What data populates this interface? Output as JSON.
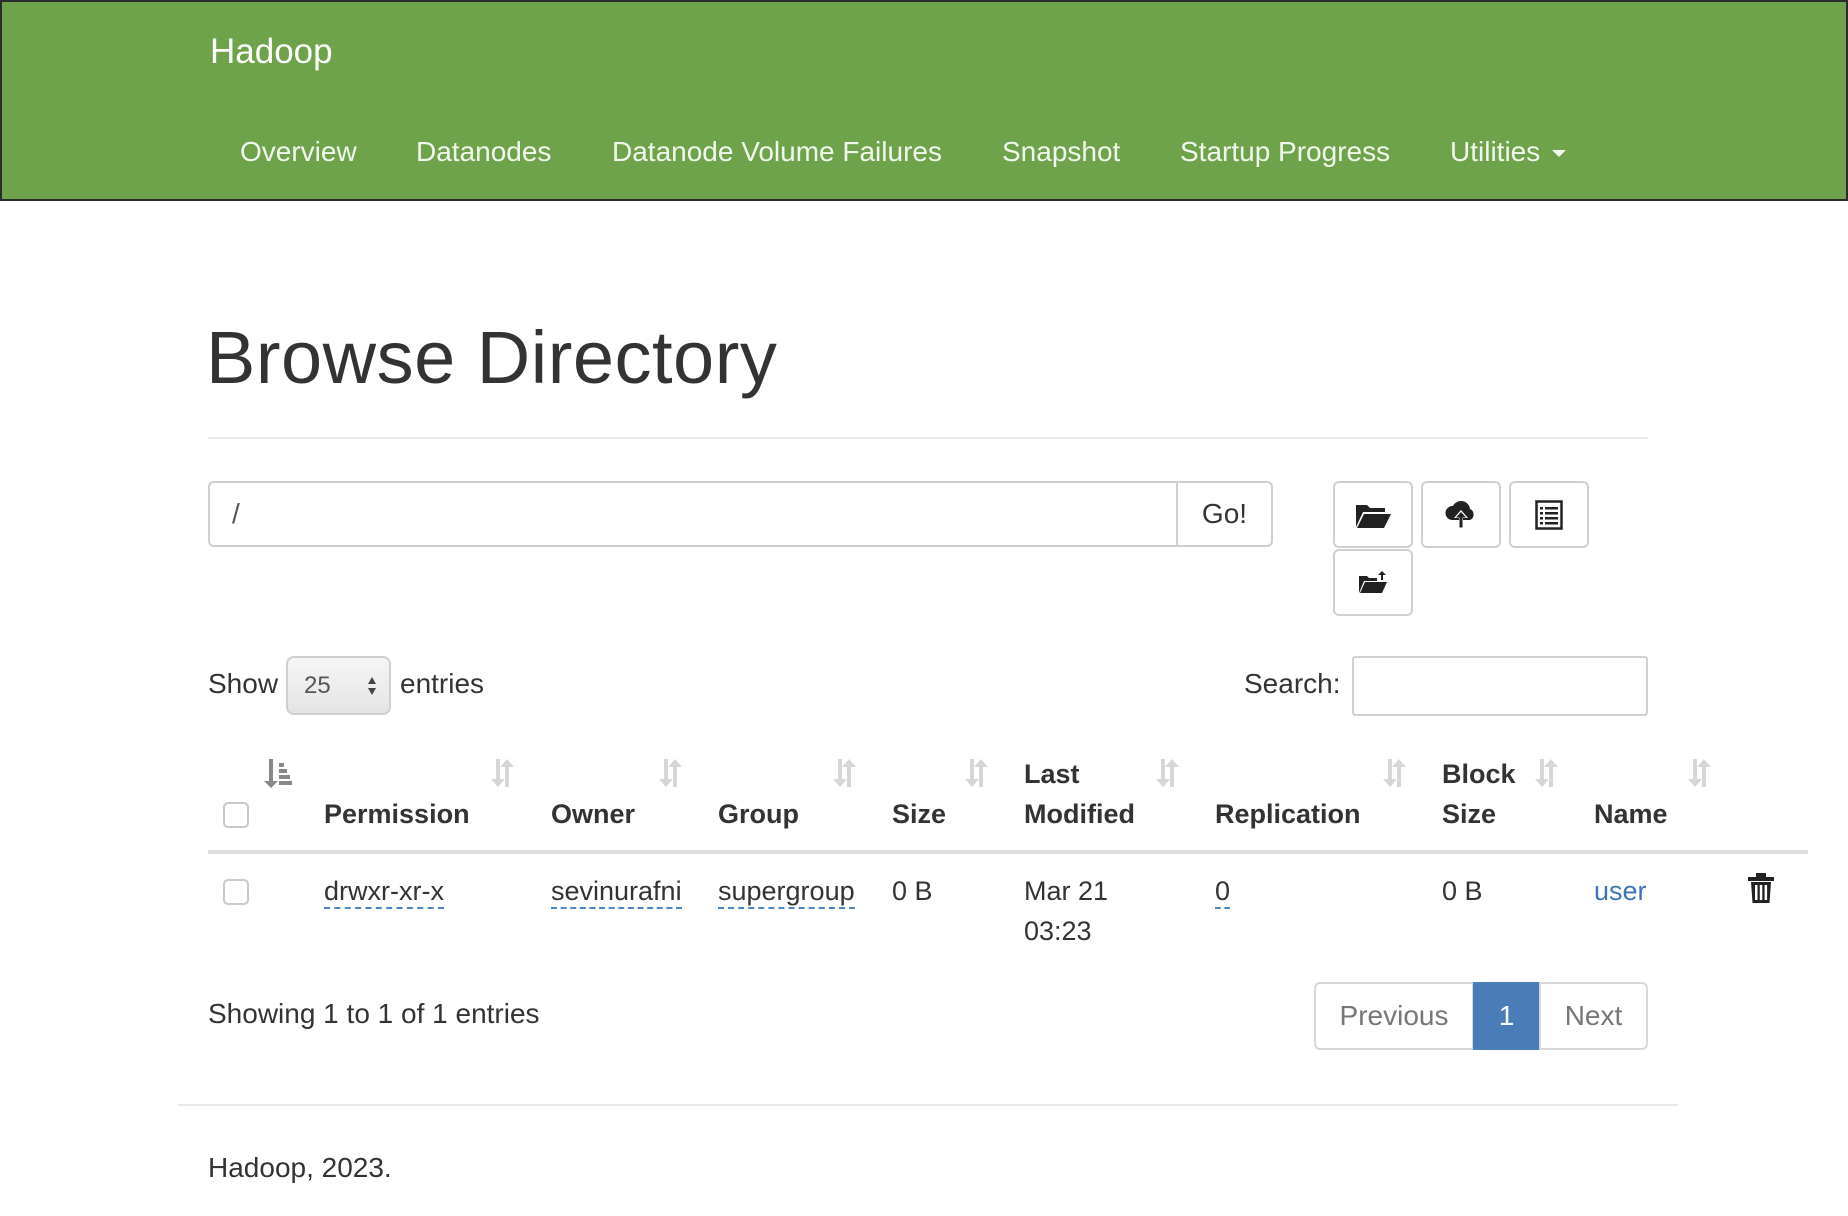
{
  "navbar": {
    "brand": "Hadoop",
    "items": [
      "Overview",
      "Datanodes",
      "Datanode Volume Failures",
      "Snapshot",
      "Startup Progress",
      "Utilities"
    ],
    "color": "#6ea34c"
  },
  "page": {
    "title": "Browse Directory"
  },
  "path_bar": {
    "value": "/",
    "go_label": "Go!"
  },
  "toolbar": {
    "icons": [
      "folder-open-icon",
      "cloud-upload-icon",
      "list-icon",
      "folder-move-icon"
    ]
  },
  "table_controls": {
    "show_label": "Show",
    "entries_value": "25",
    "entries_label": "entries",
    "search_label": "Search:"
  },
  "table": {
    "columns": [
      "Permission",
      "Owner",
      "Group",
      "Size",
      "Last Modified",
      "Replication",
      "Block Size",
      "Name"
    ],
    "column_label_lines": {
      "last_modified": [
        "Last",
        "Modified"
      ],
      "block_size": [
        "Block",
        "Size"
      ]
    },
    "rows": [
      {
        "permission": "drwxr-xr-x",
        "owner": "sevinurafni",
        "group": "supergroup",
        "size": "0 B",
        "last_modified_date": "Mar 21",
        "last_modified_time": "03:23",
        "replication": "0",
        "block_size": "0 B",
        "name": "user"
      }
    ]
  },
  "pagination": {
    "info": "Showing 1 to 1 of 1 entries",
    "previous": "Previous",
    "current": "1",
    "next": "Next",
    "active_color": "#4a7cb8"
  },
  "footer": {
    "text": "Hadoop, 2023."
  }
}
